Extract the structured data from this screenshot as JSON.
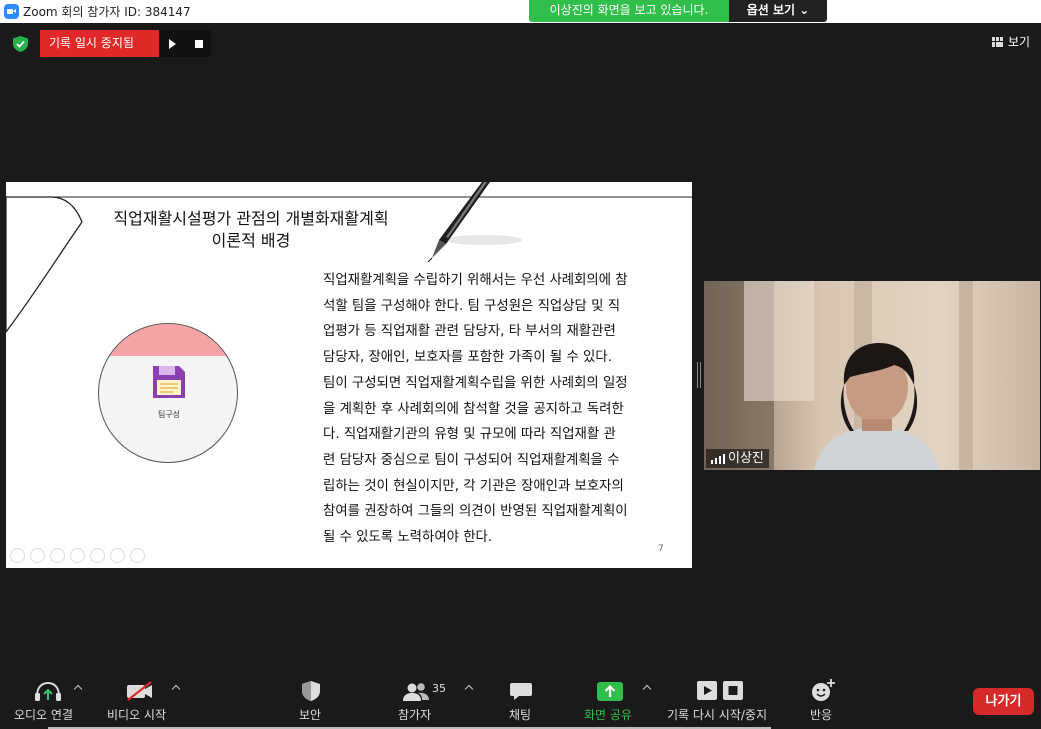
{
  "window": {
    "title": "Zoom 회의 참가자 ID: 384147",
    "share_message": "이상진의 화면을 보고 있습니다.",
    "view_options": "옵션 보기 ⌄"
  },
  "recording": {
    "status": "기록 일시 중지됨",
    "resume": "▶",
    "stop": "■"
  },
  "view_button": "보기",
  "slide": {
    "title_line1": "직업재활시설평가 관점의 개별화재활계획",
    "title_line2": "이론적 배경",
    "circle_label": "팀구성",
    "body_lines": [
      "직업재활계획을 수립하기 위해서는 우선 사례회의에 참",
      "석할 팀을 구성해야 한다. 팀 구성원은 직업상담 및 직",
      "업평가 등 직업재활 관련 담당자, 타 부서의 재활관련",
      "담당자, 장애인, 보호자를 포함한 가족이 될 수 있다.",
      "팀이 구성되면 직업재활계획수립을 위한 사례회의 일정",
      "을 계획한 후 사례회의에 참석할 것을 공지하고 독려한",
      "다. 직업재활기관의 유형 및 규모에 따라 직업재활 관",
      "련 담당자 중심으로 팀이 구성되어 직업재활계획을 수",
      "립하는 것이 현실이지만, 각 기관은 장애인과 보호자의",
      "참여를 권장하여 그들의 의견이 반영된 직업재활계획이",
      "될 수 있도록 노력하여야 한다."
    ],
    "page_number": "7"
  },
  "participant_video": {
    "name": "이상진"
  },
  "toolbar": {
    "audio": "오디오 연결",
    "video": "비디오 시작",
    "security": "보안",
    "participants": "참가자",
    "participants_count": "35",
    "chat": "채팅",
    "share": "화면 공유",
    "recording": "기록 다시 시작/중지",
    "reactions": "반응",
    "leave": "나가기"
  },
  "colors": {
    "share_green": "#2fbf4a",
    "record_red": "#e02828",
    "leave_red": "#d62a2a",
    "toolbar_bg": "#1a1a1a"
  }
}
